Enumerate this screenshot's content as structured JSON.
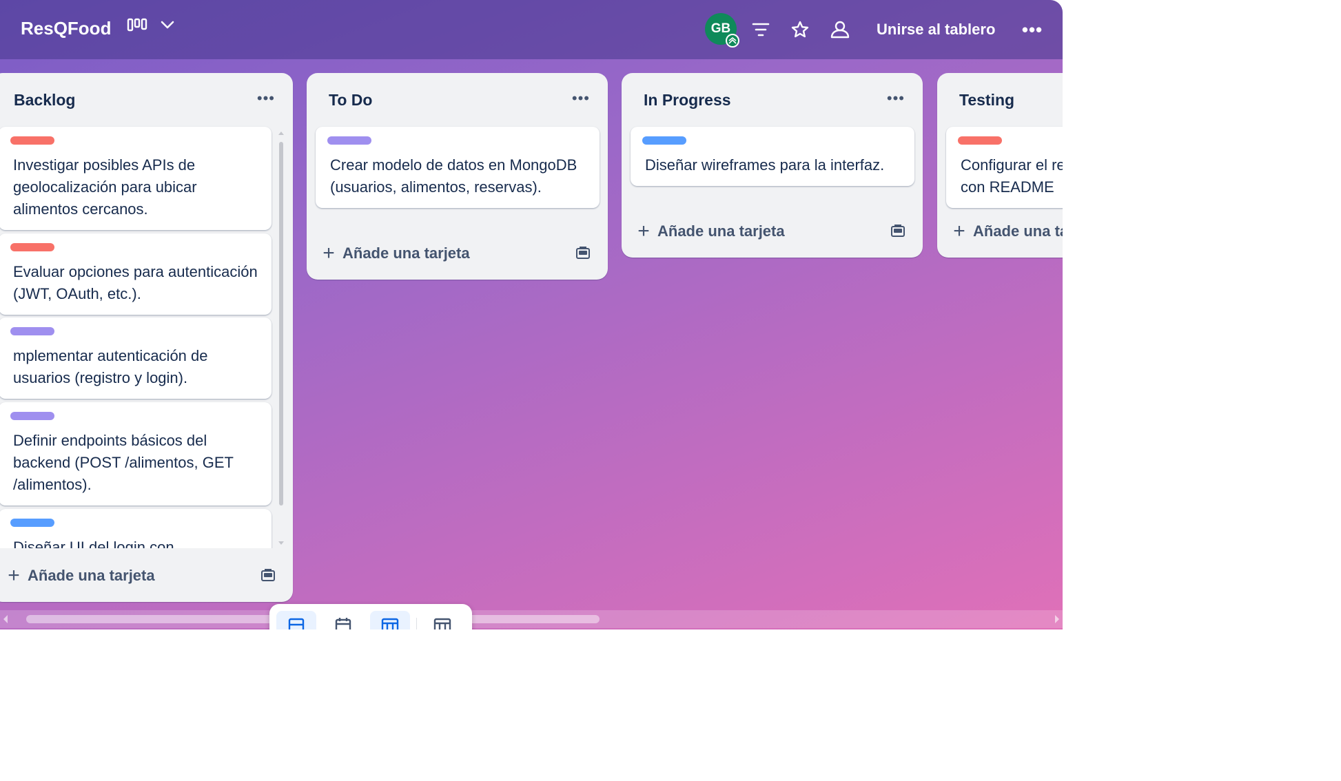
{
  "header": {
    "board_title": "ResQFood",
    "avatar_initials": "GB",
    "join_label": "Unirse al tablero",
    "more_label": "•••"
  },
  "lists": [
    {
      "title": "Backlog",
      "menu": "•••",
      "cards": [
        {
          "label_color": "#f87168",
          "text": "Investigar posibles APIs de geolocalización para ubicar alimentos cercanos."
        },
        {
          "label_color": "#f87168",
          "text": "Evaluar opciones para autenticación (JWT, OAuth, etc.)."
        },
        {
          "label_color": "#9f8fef",
          "text": "mplementar autenticación de usuarios (registro y login)."
        },
        {
          "label_color": "#9f8fef",
          "text": "Definir endpoints básicos del backend (POST /alimentos, GET /alimentos)."
        },
        {
          "label_color": "#579dff",
          "text": "Diseñar UI del login con"
        }
      ],
      "add_label": "Añade una tarjeta"
    },
    {
      "title": "To Do",
      "menu": "•••",
      "cards": [
        {
          "label_color": "#9f8fef",
          "text": "Crear modelo de datos en MongoDB (usuarios, alimentos, reservas)."
        }
      ],
      "add_label": "Añade una tarjeta"
    },
    {
      "title": "In Progress",
      "menu": "•••",
      "cards": [
        {
          "label_color": "#579dff",
          "text": "Diseñar wireframes para la interfaz."
        }
      ],
      "add_label": "Añade una tarjeta"
    },
    {
      "title": "Testing",
      "cards": [
        {
          "label_color": "#f87168",
          "text": "Configurar el repositorio en GitHub con README"
        }
      ],
      "add_label": "Añade una tarjeta"
    }
  ],
  "colors": {
    "avatar_bg": "#0f8a5a",
    "switcher_active": "#e9f2ff",
    "switcher_icon_active": "#0c66e4"
  },
  "icons": [
    "board-view-icon",
    "chevron-down-icon",
    "filter-icon",
    "star-icon",
    "share-icon",
    "plus-icon",
    "card-template-icon",
    "inbox-icon",
    "calendar-icon",
    "board-icon",
    "switch-boards-icon"
  ]
}
